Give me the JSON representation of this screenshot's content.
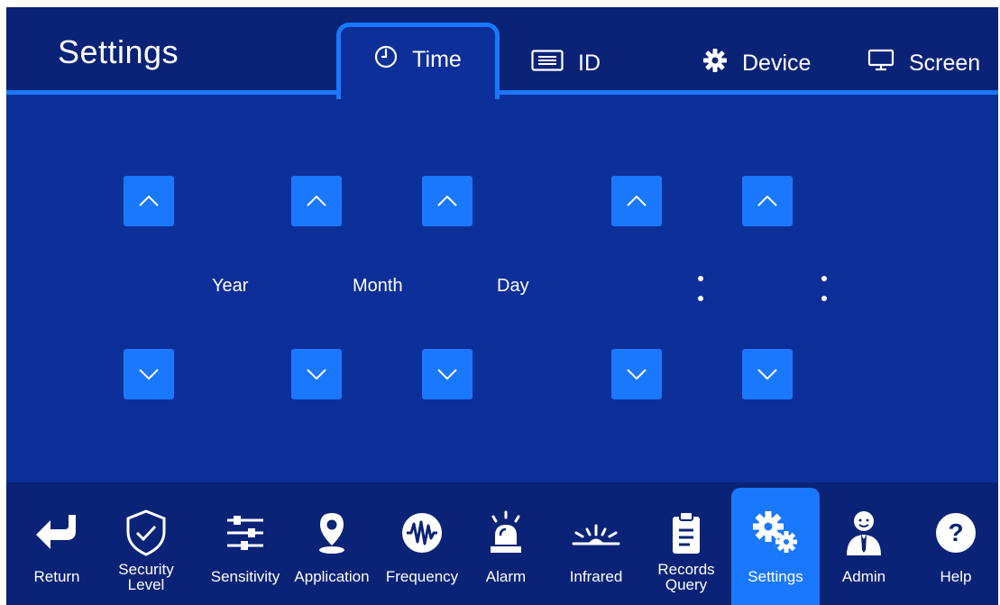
{
  "header": {
    "title": "Settings",
    "tabs": [
      {
        "label": "Time",
        "icon": "clock-icon",
        "active": true
      },
      {
        "label": "ID",
        "icon": "id-card-icon",
        "active": false
      },
      {
        "label": "Device",
        "icon": "gear-icon",
        "active": false
      },
      {
        "label": "Screen",
        "icon": "monitor-icon",
        "active": false
      }
    ]
  },
  "time_panel": {
    "labels": {
      "year": "Year",
      "month": "Month",
      "day": "Day"
    },
    "separator": ":",
    "values": {
      "year": "",
      "month": "",
      "day": "",
      "hour": "",
      "minute": "",
      "second": ""
    }
  },
  "bottom_nav": {
    "items": [
      {
        "label": "Return",
        "icon": "return-arrow-icon"
      },
      {
        "label": "Security Level",
        "icon": "shield-check-icon"
      },
      {
        "label": "Sensitivity",
        "icon": "sliders-icon"
      },
      {
        "label": "Application",
        "icon": "location-pin-icon"
      },
      {
        "label": "Frequency",
        "icon": "waveform-icon"
      },
      {
        "label": "Alarm",
        "icon": "alarm-siren-icon"
      },
      {
        "label": "Infrared",
        "icon": "infrared-icon"
      },
      {
        "label": "Records Query",
        "icon": "clipboard-icon"
      },
      {
        "label": "Settings",
        "icon": "gears-icon",
        "active": true
      },
      {
        "label": "Admin",
        "icon": "admin-user-icon"
      },
      {
        "label": "Help",
        "icon": "help-icon"
      }
    ]
  },
  "colors": {
    "background": "#0d2f99",
    "header": "#0b2377",
    "accent": "#1a78ff",
    "text": "#ffffff"
  }
}
